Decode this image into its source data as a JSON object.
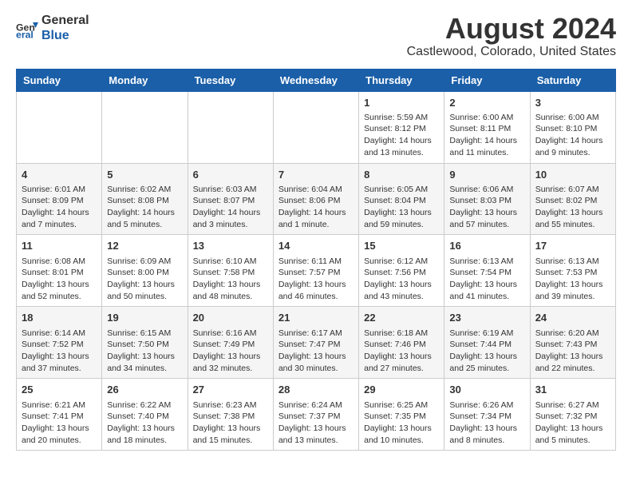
{
  "logo": {
    "general": "General",
    "blue": "Blue"
  },
  "title": "August 2024",
  "location": "Castlewood, Colorado, United States",
  "days_of_week": [
    "Sunday",
    "Monday",
    "Tuesday",
    "Wednesday",
    "Thursday",
    "Friday",
    "Saturday"
  ],
  "weeks": [
    [
      {
        "day": "",
        "content": ""
      },
      {
        "day": "",
        "content": ""
      },
      {
        "day": "",
        "content": ""
      },
      {
        "day": "",
        "content": ""
      },
      {
        "day": "1",
        "content": "Sunrise: 5:59 AM\nSunset: 8:12 PM\nDaylight: 14 hours\nand 13 minutes."
      },
      {
        "day": "2",
        "content": "Sunrise: 6:00 AM\nSunset: 8:11 PM\nDaylight: 14 hours\nand 11 minutes."
      },
      {
        "day": "3",
        "content": "Sunrise: 6:00 AM\nSunset: 8:10 PM\nDaylight: 14 hours\nand 9 minutes."
      }
    ],
    [
      {
        "day": "4",
        "content": "Sunrise: 6:01 AM\nSunset: 8:09 PM\nDaylight: 14 hours\nand 7 minutes."
      },
      {
        "day": "5",
        "content": "Sunrise: 6:02 AM\nSunset: 8:08 PM\nDaylight: 14 hours\nand 5 minutes."
      },
      {
        "day": "6",
        "content": "Sunrise: 6:03 AM\nSunset: 8:07 PM\nDaylight: 14 hours\nand 3 minutes."
      },
      {
        "day": "7",
        "content": "Sunrise: 6:04 AM\nSunset: 8:06 PM\nDaylight: 14 hours\nand 1 minute."
      },
      {
        "day": "8",
        "content": "Sunrise: 6:05 AM\nSunset: 8:04 PM\nDaylight: 13 hours\nand 59 minutes."
      },
      {
        "day": "9",
        "content": "Sunrise: 6:06 AM\nSunset: 8:03 PM\nDaylight: 13 hours\nand 57 minutes."
      },
      {
        "day": "10",
        "content": "Sunrise: 6:07 AM\nSunset: 8:02 PM\nDaylight: 13 hours\nand 55 minutes."
      }
    ],
    [
      {
        "day": "11",
        "content": "Sunrise: 6:08 AM\nSunset: 8:01 PM\nDaylight: 13 hours\nand 52 minutes."
      },
      {
        "day": "12",
        "content": "Sunrise: 6:09 AM\nSunset: 8:00 PM\nDaylight: 13 hours\nand 50 minutes."
      },
      {
        "day": "13",
        "content": "Sunrise: 6:10 AM\nSunset: 7:58 PM\nDaylight: 13 hours\nand 48 minutes."
      },
      {
        "day": "14",
        "content": "Sunrise: 6:11 AM\nSunset: 7:57 PM\nDaylight: 13 hours\nand 46 minutes."
      },
      {
        "day": "15",
        "content": "Sunrise: 6:12 AM\nSunset: 7:56 PM\nDaylight: 13 hours\nand 43 minutes."
      },
      {
        "day": "16",
        "content": "Sunrise: 6:13 AM\nSunset: 7:54 PM\nDaylight: 13 hours\nand 41 minutes."
      },
      {
        "day": "17",
        "content": "Sunrise: 6:13 AM\nSunset: 7:53 PM\nDaylight: 13 hours\nand 39 minutes."
      }
    ],
    [
      {
        "day": "18",
        "content": "Sunrise: 6:14 AM\nSunset: 7:52 PM\nDaylight: 13 hours\nand 37 minutes."
      },
      {
        "day": "19",
        "content": "Sunrise: 6:15 AM\nSunset: 7:50 PM\nDaylight: 13 hours\nand 34 minutes."
      },
      {
        "day": "20",
        "content": "Sunrise: 6:16 AM\nSunset: 7:49 PM\nDaylight: 13 hours\nand 32 minutes."
      },
      {
        "day": "21",
        "content": "Sunrise: 6:17 AM\nSunset: 7:47 PM\nDaylight: 13 hours\nand 30 minutes."
      },
      {
        "day": "22",
        "content": "Sunrise: 6:18 AM\nSunset: 7:46 PM\nDaylight: 13 hours\nand 27 minutes."
      },
      {
        "day": "23",
        "content": "Sunrise: 6:19 AM\nSunset: 7:44 PM\nDaylight: 13 hours\nand 25 minutes."
      },
      {
        "day": "24",
        "content": "Sunrise: 6:20 AM\nSunset: 7:43 PM\nDaylight: 13 hours\nand 22 minutes."
      }
    ],
    [
      {
        "day": "25",
        "content": "Sunrise: 6:21 AM\nSunset: 7:41 PM\nDaylight: 13 hours\nand 20 minutes."
      },
      {
        "day": "26",
        "content": "Sunrise: 6:22 AM\nSunset: 7:40 PM\nDaylight: 13 hours\nand 18 minutes."
      },
      {
        "day": "27",
        "content": "Sunrise: 6:23 AM\nSunset: 7:38 PM\nDaylight: 13 hours\nand 15 minutes."
      },
      {
        "day": "28",
        "content": "Sunrise: 6:24 AM\nSunset: 7:37 PM\nDaylight: 13 hours\nand 13 minutes."
      },
      {
        "day": "29",
        "content": "Sunrise: 6:25 AM\nSunset: 7:35 PM\nDaylight: 13 hours\nand 10 minutes."
      },
      {
        "day": "30",
        "content": "Sunrise: 6:26 AM\nSunset: 7:34 PM\nDaylight: 13 hours\nand 8 minutes."
      },
      {
        "day": "31",
        "content": "Sunrise: 6:27 AM\nSunset: 7:32 PM\nDaylight: 13 hours\nand 5 minutes."
      }
    ]
  ]
}
